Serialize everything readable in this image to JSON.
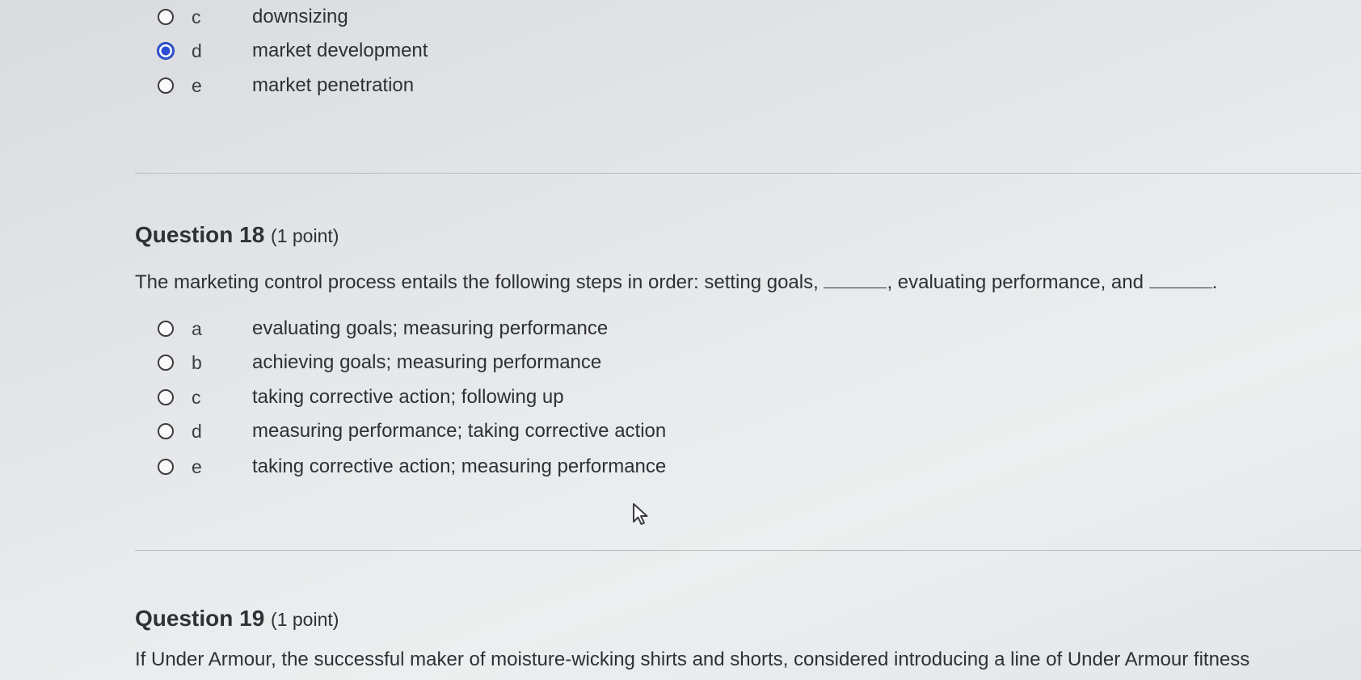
{
  "q17": {
    "options": [
      {
        "letter": "c",
        "text": "downsizing",
        "selected": false
      },
      {
        "letter": "d",
        "text": "market development",
        "selected": true
      },
      {
        "letter": "e",
        "text": "market penetration",
        "selected": false
      }
    ]
  },
  "q18": {
    "title": "Question 18",
    "points": "(1 point)",
    "text_part1": "The marketing control process entails the following steps in order: setting goals,",
    "text_part2": ", evaluating performance, and",
    "text_part3": ".",
    "options": [
      {
        "letter": "a",
        "text": "evaluating goals; measuring performance",
        "selected": false
      },
      {
        "letter": "b",
        "text": "achieving goals; measuring performance",
        "selected": false
      },
      {
        "letter": "c",
        "text": "taking corrective action; following up",
        "selected": false
      },
      {
        "letter": "d",
        "text": "measuring performance; taking corrective action",
        "selected": false
      },
      {
        "letter": "e",
        "text": "taking corrective action; measuring performance",
        "selected": false
      }
    ]
  },
  "q19": {
    "title": "Question 19",
    "points": "(1 point)",
    "text": "If Under Armour, the successful maker of moisture-wicking shirts and shorts, considered introducing a line of Under Armour fitness"
  },
  "colors": {
    "selected_radio": "#2a4fd6"
  },
  "icons": {
    "cursor": "mouse-pointer-icon"
  }
}
